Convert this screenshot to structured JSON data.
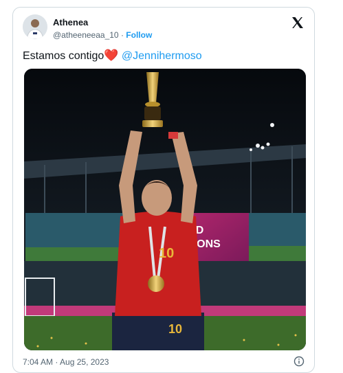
{
  "author": {
    "name": "Athenea",
    "handle": "@atheeneeaa_10",
    "separator": " · ",
    "follow_label": "Follow"
  },
  "tweet": {
    "text": "Estamos contigo",
    "emoji": "❤️",
    "mention": "@Jennihermoso"
  },
  "media": {
    "banner_text_line1": "LD",
    "banner_text_line2": "PIONS",
    "jersey_number": "10"
  },
  "meta": {
    "timestamp": "7:04 AM · Aug 25, 2023"
  },
  "icons": {
    "platform": "x-logo-icon",
    "info": "info-icon"
  },
  "colors": {
    "link": "#1d9bf0",
    "text": "#0f1419",
    "muted": "#536471",
    "border": "#cfd9de",
    "heart": "#e0245e"
  }
}
